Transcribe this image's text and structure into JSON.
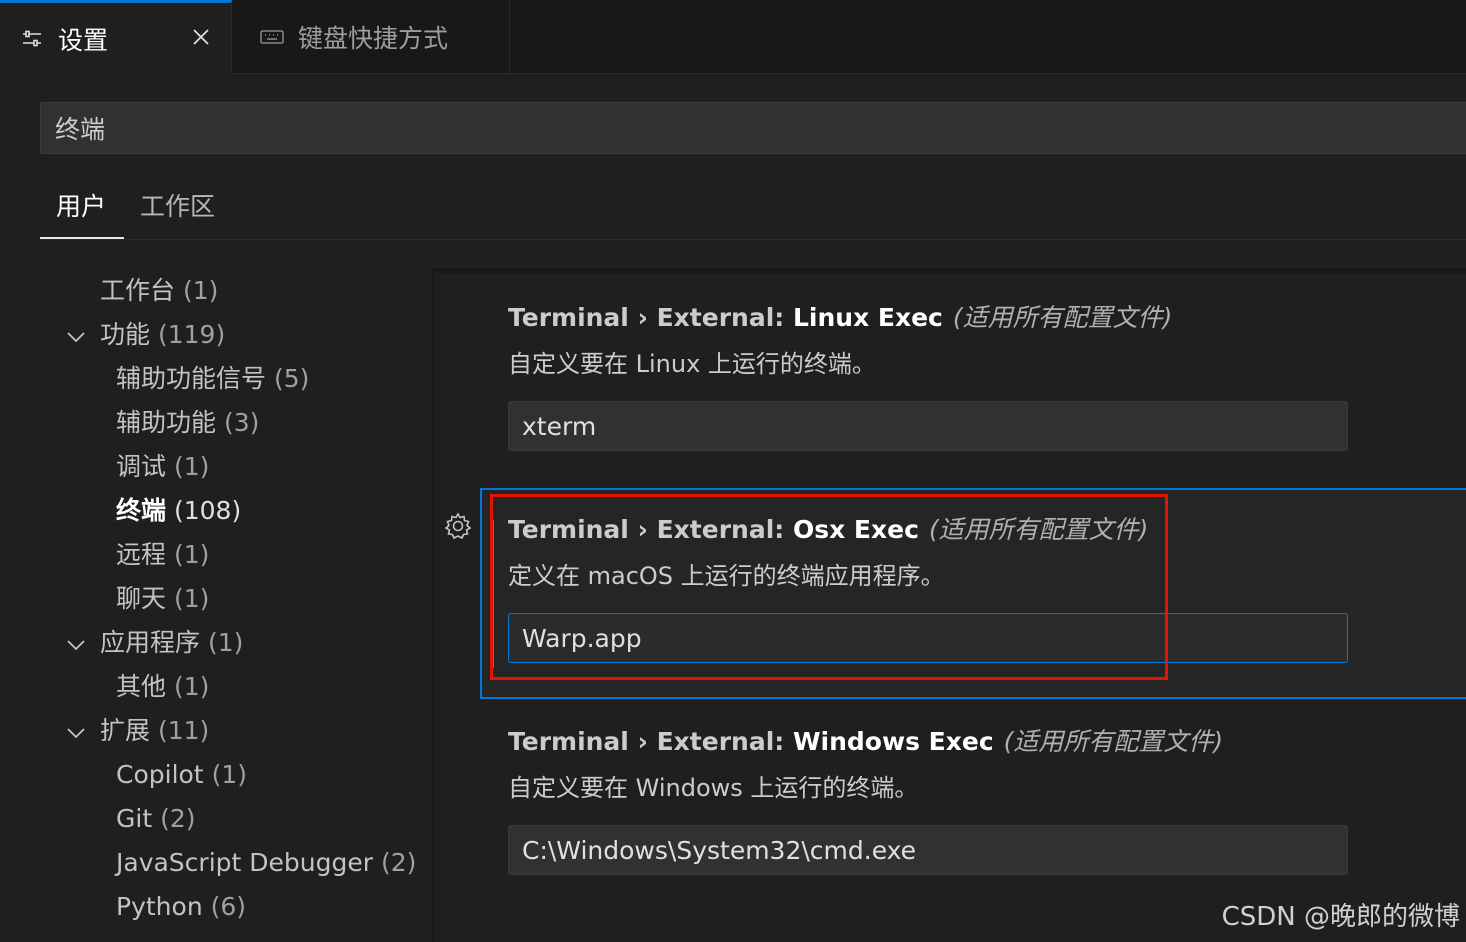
{
  "tabs": {
    "settings_label": "设置",
    "keybindings_label": "键盘快捷方式"
  },
  "search": {
    "value": "终端"
  },
  "scopes": {
    "user": "用户",
    "workspace": "工作区"
  },
  "toc": [
    {
      "label": "工作台",
      "count": "(1)"
    },
    {
      "label": "功能",
      "count": "(119)"
    },
    {
      "label": "辅助功能信号",
      "count": "(5)"
    },
    {
      "label": "辅助功能",
      "count": "(3)"
    },
    {
      "label": "调试",
      "count": "(1)"
    },
    {
      "label": "终端",
      "count": "(108)"
    },
    {
      "label": "远程",
      "count": "(1)"
    },
    {
      "label": "聊天",
      "count": "(1)"
    },
    {
      "label": "应用程序",
      "count": "(1)"
    },
    {
      "label": "其他",
      "count": "(1)"
    },
    {
      "label": "扩展",
      "count": "(11)"
    },
    {
      "label": "Copilot",
      "count": "(1)"
    },
    {
      "label": "Git",
      "count": "(2)"
    },
    {
      "label": "JavaScript Debugger",
      "count": "(2)"
    },
    {
      "label": "Python",
      "count": "(6)"
    }
  ],
  "settings": [
    {
      "category": "Terminal › External: ",
      "name": "Linux Exec",
      "scope": "(适用所有配置文件)",
      "description": "自定义要在 Linux 上运行的终端。",
      "value": "xterm"
    },
    {
      "category": "Terminal › External: ",
      "name": "Osx Exec",
      "scope": "(适用所有配置文件)",
      "description": "定义在 macOS 上运行的终端应用程序。",
      "value": "Warp.app"
    },
    {
      "category": "Terminal › External: ",
      "name": "Windows Exec",
      "scope": "(适用所有配置文件)",
      "description": "自定义要在 Windows 上运行的终端。",
      "value": "C:\\Windows\\System32\\cmd.exe"
    }
  ],
  "watermark": "CSDN @晚郎的微博",
  "colors": {
    "accent": "#0078d4",
    "highlight_box": "#e51400",
    "background": "#1f1f1f"
  }
}
